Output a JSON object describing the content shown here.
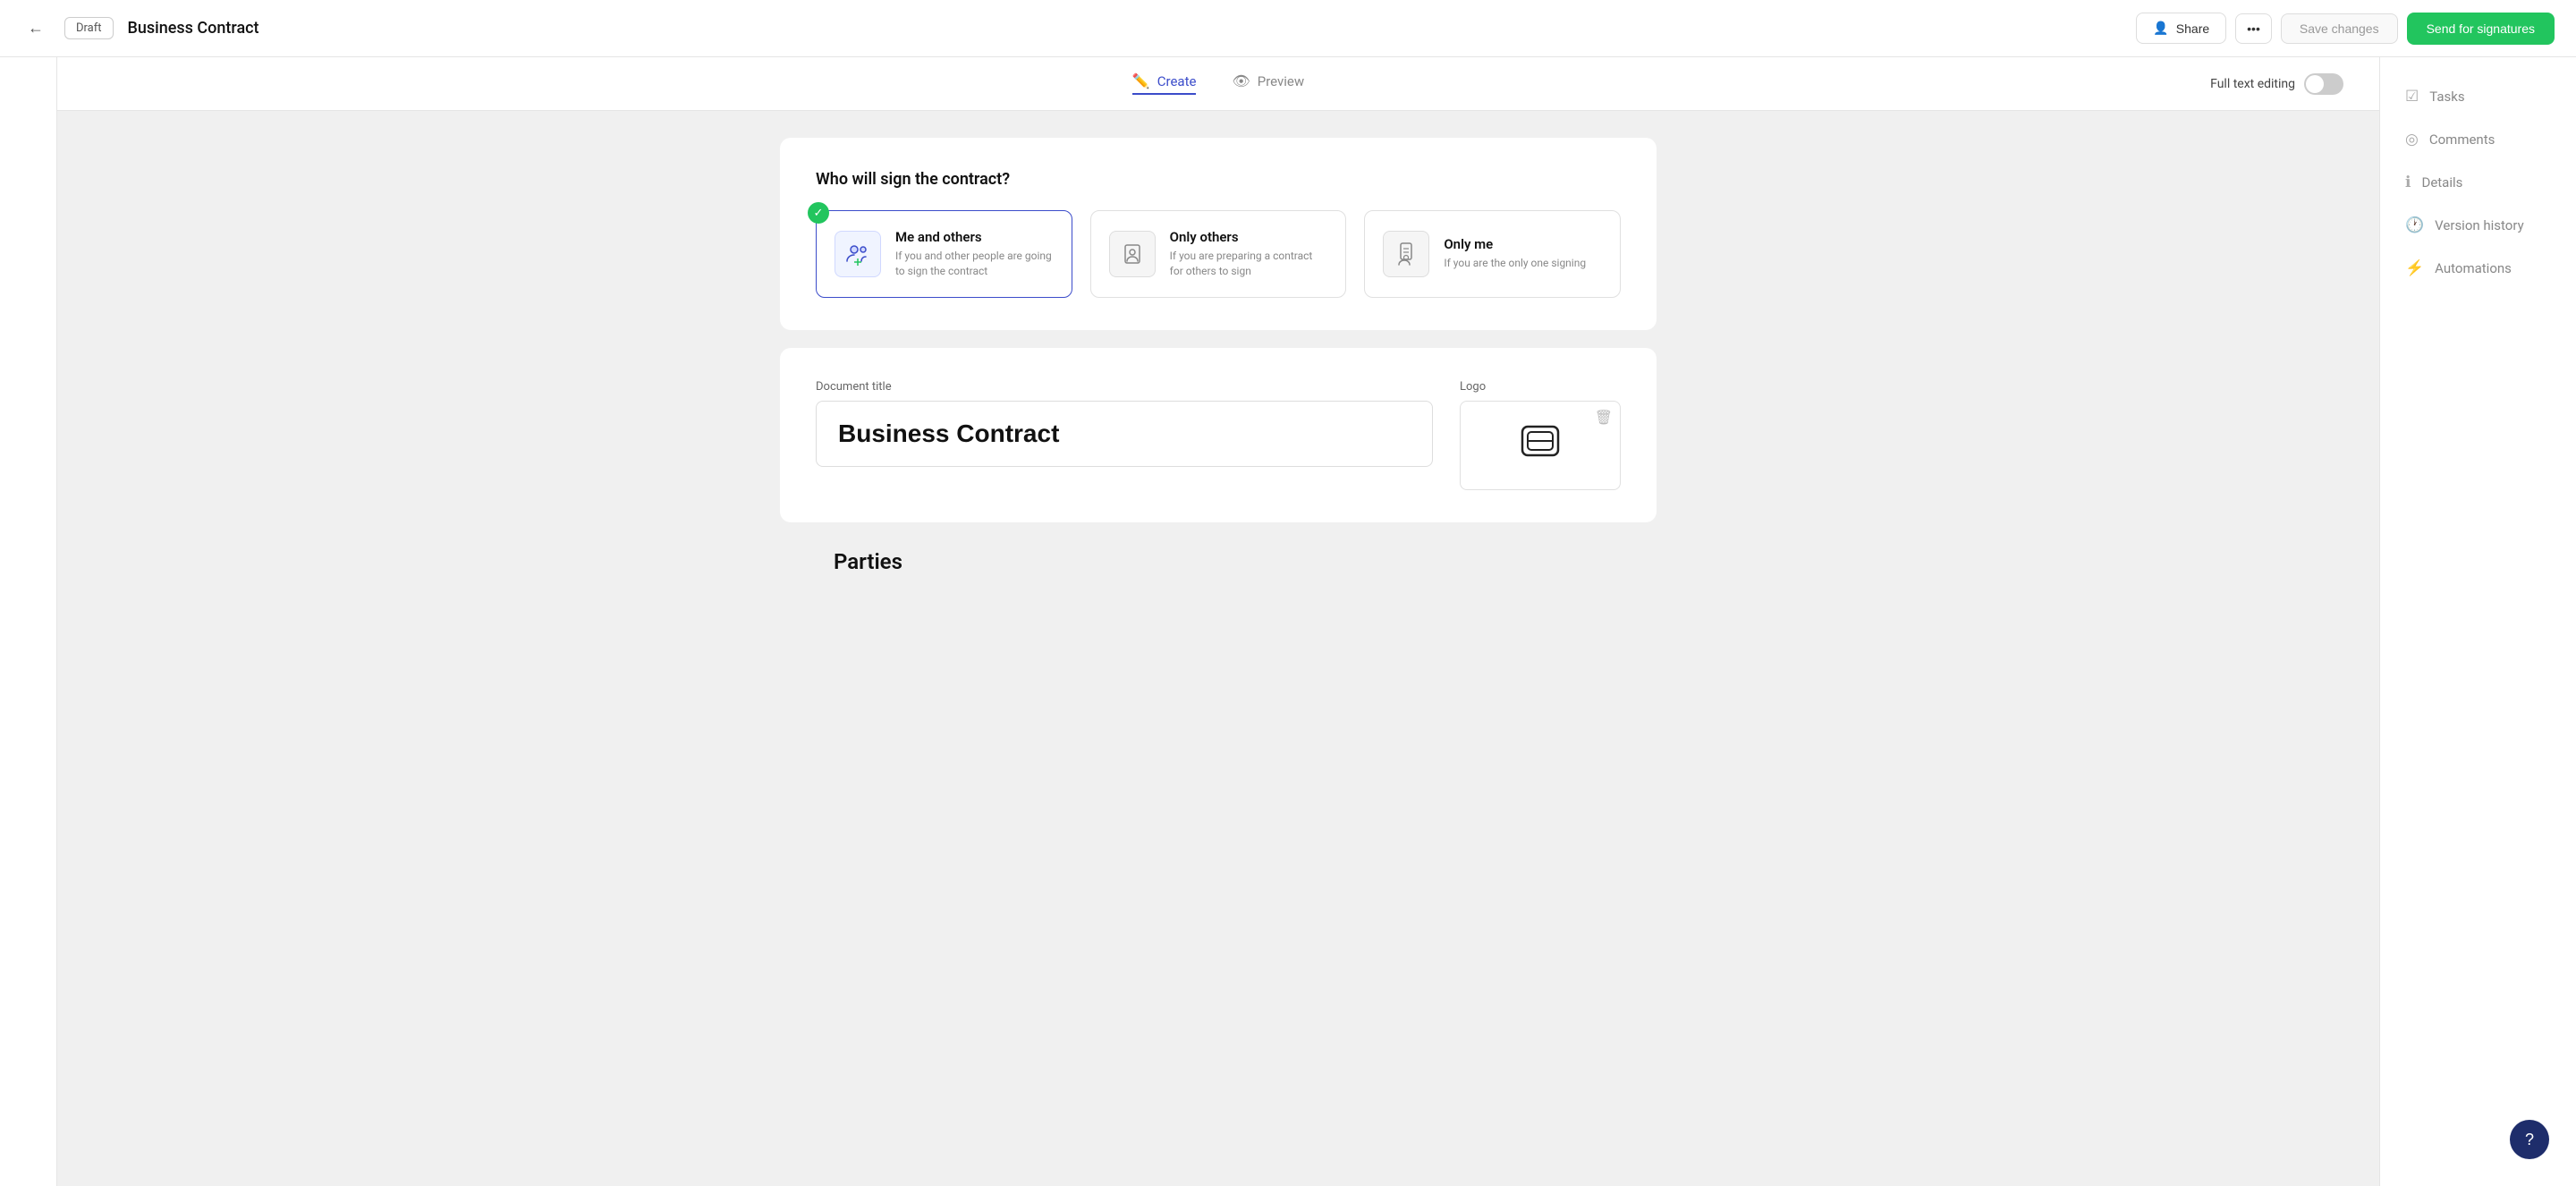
{
  "topbar": {
    "back_icon": "←",
    "draft_label": "Draft",
    "doc_title": "Business Contract",
    "share_label": "Share",
    "share_icon": "👤",
    "more_icon": "•••",
    "save_label": "Save changes",
    "send_label": "Send for signatures"
  },
  "tabs": {
    "create_label": "Create",
    "preview_label": "Preview",
    "full_text_label": "Full text editing"
  },
  "signer_section": {
    "title": "Who will sign the contract?",
    "options": [
      {
        "id": "me-and-others",
        "selected": true,
        "title": "Me and others",
        "description": "If you and other people are going to sign the contract"
      },
      {
        "id": "only-others",
        "selected": false,
        "title": "Only others",
        "description": "If you are preparing a contract for others to sign"
      },
      {
        "id": "only-me",
        "selected": false,
        "title": "Only me",
        "description": "If you are the only one signing"
      }
    ]
  },
  "document_section": {
    "title_label": "Document title",
    "title_value": "Business Contract",
    "logo_label": "Logo"
  },
  "parties_section": {
    "title": "Parties"
  },
  "right_sidebar": {
    "items": [
      {
        "id": "tasks",
        "label": "Tasks",
        "icon": "☑"
      },
      {
        "id": "comments",
        "label": "Comments",
        "icon": "◎"
      },
      {
        "id": "details",
        "label": "Details",
        "icon": "ℹ"
      },
      {
        "id": "version-history",
        "label": "Version history",
        "icon": "🕐"
      },
      {
        "id": "automations",
        "label": "Automations",
        "icon": "⚡"
      }
    ]
  },
  "help_label": "?",
  "colors": {
    "accent": "#3b4cca",
    "green": "#22c55e",
    "dark_navy": "#1e2d6b"
  }
}
